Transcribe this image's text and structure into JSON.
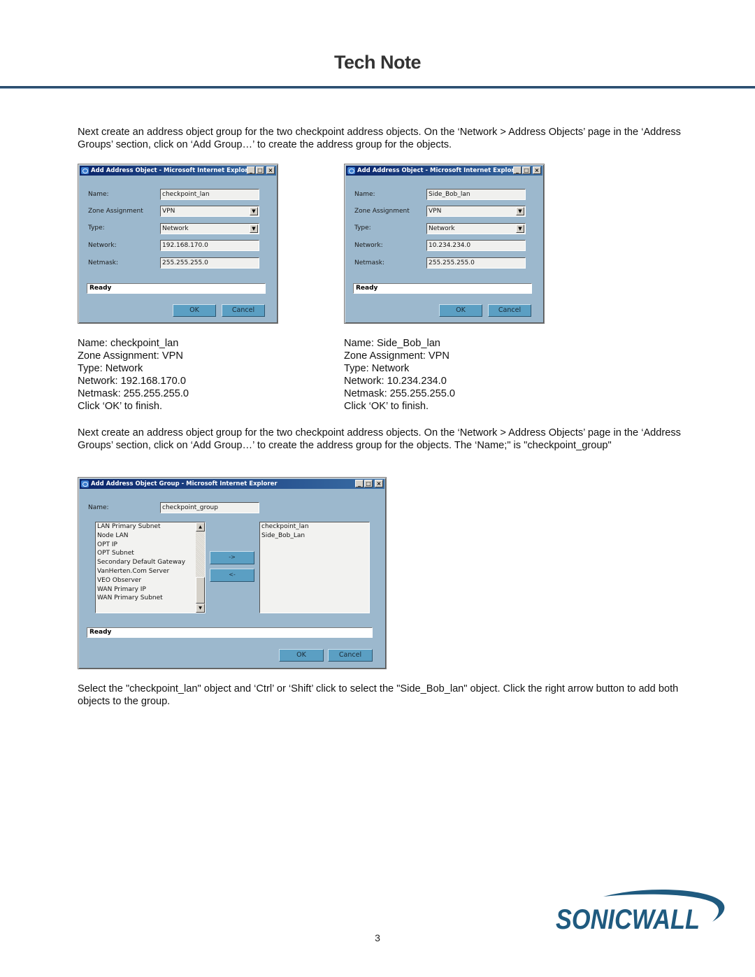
{
  "header": {
    "title": "Tech Note"
  },
  "paragraphs": {
    "intro": "Next create an address object group for the two checkpoint address objects. On the ‘Network > Address Objects’ page in the ‘Address Groups’ section, click on ‘Add Group…’ to create the address group for the objects.",
    "group_intro": "Next create an address object group for the two checkpoint address objects. On the ‘Network > Address Objects’ page in the ‘Address Groups’ section, click on ‘Add Group…’ to create the address group for the objects. The ‘Name;\" is \"checkpoint_group\"",
    "select_instructions": "Select the \"checkpoint_lan\" object and ‘Ctrl’ or ‘Shift’ click to select the \"Side_Bob_lan\" object. Click the right arrow button to add both objects to the group."
  },
  "dialogs": [
    {
      "title": "Add Address Object - Microsoft Internet Explorer",
      "labels": {
        "name": "Name:",
        "zone": "Zone Assignment",
        "type": "Type:",
        "network": "Network:",
        "netmask": "Netmask:"
      },
      "values": {
        "name": "checkpoint_lan",
        "zone": "VPN",
        "type": "Network",
        "network": "192.168.170.0",
        "netmask": "255.255.255.0"
      },
      "status": "Ready",
      "ok": "OK",
      "cancel": "Cancel"
    },
    {
      "title": "Add Address Object - Microsoft Internet Explorer",
      "labels": {
        "name": "Name:",
        "zone": "Zone Assignment",
        "type": "Type:",
        "network": "Network:",
        "netmask": "Netmask:"
      },
      "values": {
        "name": "Side_Bob_lan",
        "zone": "VPN",
        "type": "Network",
        "network": "10.234.234.0",
        "netmask": "255.255.255.0"
      },
      "status": "Ready",
      "ok": "OK",
      "cancel": "Cancel"
    }
  ],
  "captions": [
    [
      "Name: checkpoint_lan",
      "Zone Assignment: VPN",
      "Type: Network",
      "Network: 192.168.170.0",
      "Netmask: 255.255.255.0",
      "Click ‘OK’ to finish."
    ],
    [
      "Name: Side_Bob_lan",
      "Zone Assignment: VPN",
      "Type: Network",
      "Network: 10.234.234.0",
      "Netmask: 255.255.255.0",
      "Click ‘OK’ to finish."
    ]
  ],
  "group_dialog": {
    "title": "Add Address Object Group - Microsoft Internet Explorer",
    "name_label": "Name:",
    "name_value": "checkpoint_group",
    "available": [
      "LAN Primary Subnet",
      "Node LAN",
      "OPT IP",
      "OPT Subnet",
      "Secondary Default Gateway",
      "VanHerten.Com Server",
      "VEO Observer",
      "WAN Primary IP",
      "WAN Primary Subnet"
    ],
    "selected": [
      "checkpoint_lan",
      "Side_Bob_Lan"
    ],
    "add_button": "->",
    "remove_button": "<-",
    "status": "Ready",
    "ok": "OK",
    "cancel": "Cancel"
  },
  "window_buttons": {
    "minimize": "_",
    "maximize": "□",
    "close": "×"
  },
  "logo": {
    "text": "SONICWALL",
    "color": "#1f5a7f"
  },
  "footer": {
    "page_number": "3"
  }
}
